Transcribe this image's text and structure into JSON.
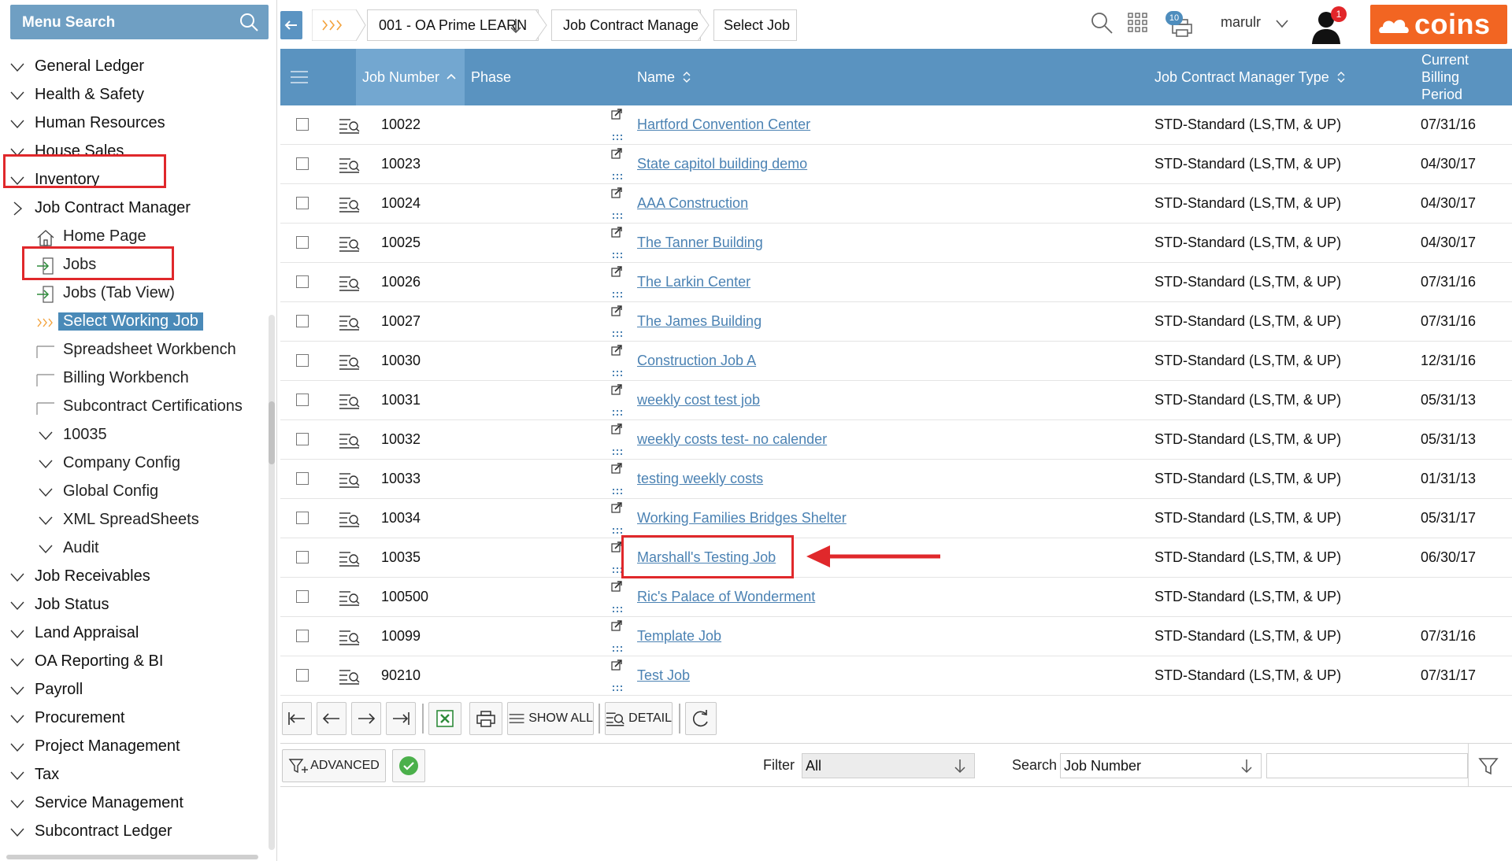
{
  "sidebar": {
    "search_label": "Menu Search",
    "items": [
      {
        "label": "General Ledger"
      },
      {
        "label": "Health & Safety"
      },
      {
        "label": "Human Resources"
      },
      {
        "label": "House Sales"
      },
      {
        "label": "Inventory"
      },
      {
        "label": "Job Contract Manager"
      },
      {
        "label": "Home Page"
      },
      {
        "label": "Jobs"
      },
      {
        "label": "Jobs (Tab View)"
      },
      {
        "label": "Select Working Job"
      },
      {
        "label": "Spreadsheet Workbench"
      },
      {
        "label": "Billing Workbench"
      },
      {
        "label": "Subcontract Certifications"
      },
      {
        "label": "10035"
      },
      {
        "label": "Company Config"
      },
      {
        "label": "Global Config"
      },
      {
        "label": "XML SpreadSheets"
      },
      {
        "label": "Audit"
      },
      {
        "label": "Job Receivables"
      },
      {
        "label": "Job Status"
      },
      {
        "label": "Land Appraisal"
      },
      {
        "label": "OA Reporting & BI"
      },
      {
        "label": "Payroll"
      },
      {
        "label": "Procurement"
      },
      {
        "label": "Project Management"
      },
      {
        "label": "Tax"
      },
      {
        "label": "Service Management"
      },
      {
        "label": "Subcontract Ledger"
      }
    ]
  },
  "topbar": {
    "breadcrumbs": [
      "001 - OA Prime LEARN",
      "Job Contract Manager",
      "Select Job"
    ],
    "print_badge": "10",
    "username": "marulr",
    "notification_badge": "1",
    "logo_text": "coins"
  },
  "grid": {
    "columns": {
      "job_number": "Job Number",
      "phase": "Phase",
      "name": "Name",
      "type": "Job Contract Manager Type",
      "period": "Current Billing Period"
    },
    "rows": [
      {
        "job": "10022",
        "name": "Hartford Convention Center",
        "type": "STD-Standard (LS,TM, & UP)",
        "period": "07/31/16"
      },
      {
        "job": "10023",
        "name": "State capitol building demo",
        "type": "STD-Standard (LS,TM, & UP)",
        "period": "04/30/17"
      },
      {
        "job": "10024",
        "name": "AAA Construction",
        "type": "STD-Standard (LS,TM, & UP)",
        "period": "04/30/17"
      },
      {
        "job": "10025",
        "name": "The Tanner Building",
        "type": "STD-Standard (LS,TM, & UP)",
        "period": "04/30/17"
      },
      {
        "job": "10026",
        "name": "The Larkin Center",
        "type": "STD-Standard (LS,TM, & UP)",
        "period": "07/31/16"
      },
      {
        "job": "10027",
        "name": "The James Building",
        "type": "STD-Standard (LS,TM, & UP)",
        "period": "07/31/16"
      },
      {
        "job": "10030",
        "name": "Construction Job A",
        "type": "STD-Standard (LS,TM, & UP)",
        "period": "12/31/16"
      },
      {
        "job": "10031",
        "name": "weekly cost test job",
        "type": "STD-Standard (LS,TM, & UP)",
        "period": "05/31/13"
      },
      {
        "job": "10032",
        "name": "weekly costs test- no calender",
        "type": "STD-Standard (LS,TM, & UP)",
        "period": "05/31/13"
      },
      {
        "job": "10033",
        "name": "testing weekly costs",
        "type": "STD-Standard (LS,TM, & UP)",
        "period": "01/31/13"
      },
      {
        "job": "10034",
        "name": "Working Families Bridges Shelter",
        "type": "STD-Standard (LS,TM, & UP)",
        "period": "05/31/17"
      },
      {
        "job": "10035",
        "name": "Marshall's Testing Job",
        "type": "STD-Standard (LS,TM, & UP)",
        "period": "06/30/17"
      },
      {
        "job": "100500",
        "name": "Ric's Palace of Wonderment",
        "type": "STD-Standard (LS,TM, & UP)",
        "period": ""
      },
      {
        "job": "10099",
        "name": "Template Job",
        "type": "STD-Standard (LS,TM, & UP)",
        "period": "07/31/16"
      },
      {
        "job": "90210",
        "name": "Test Job",
        "type": "STD-Standard (LS,TM, & UP)",
        "period": "07/31/17"
      }
    ]
  },
  "toolbar": {
    "show_all": "SHOW ALL",
    "detail": "DETAIL"
  },
  "filterbar": {
    "advanced": "ADVANCED",
    "filter_label": "Filter",
    "filter_value": "All",
    "search_label": "Search",
    "search_field_value": "Job Number",
    "search_value": ""
  },
  "colors": {
    "header_blue": "#5a93c0",
    "link_blue": "#4b82b3",
    "highlight_red": "#e0282b",
    "logo_orange": "#f26522"
  }
}
